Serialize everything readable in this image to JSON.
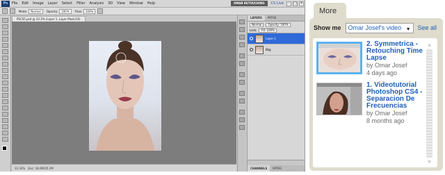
{
  "photoshop": {
    "logo": "Ps",
    "menus": [
      "File",
      "Edit",
      "Image",
      "Layer",
      "Select",
      "Filter",
      "Analysis",
      "3D",
      "View",
      "Window",
      "Help"
    ],
    "workspace_button": "OMAR RETOUCHING",
    "cs_live": "CS Live",
    "options": {
      "mode_label": "Mode:",
      "mode_value": "Normal",
      "opacity_label": "Opacity:",
      "opacity_value": "100%",
      "flow_label": "Flow:",
      "flow_value": "100%"
    },
    "document_tab": "PSCS5.psd @ 33.3% (Layer 1, Layer Mask/16)",
    "status": {
      "zoom": "33.33%",
      "doc_size": "Doc: 18.6M/35.2M"
    },
    "layers_panel": {
      "tabs": [
        "LAYERS",
        "PATHS"
      ],
      "blend_mode": "Normal",
      "opacity": "Opacity: 100%",
      "lock_label": "Lock:",
      "fill": "Fill: 100%",
      "layers": [
        {
          "name": "Layer 1",
          "selected": true
        },
        {
          "name": "Bkg",
          "selected": false
        }
      ],
      "bottom_tabs": [
        "CHANNELS",
        "PATHS"
      ]
    }
  },
  "more_panel": {
    "tab_label": "More",
    "show_me_label": "Show me",
    "show_me_value": "Omar Josef's video",
    "see_all": "See all",
    "videos": [
      {
        "number": "2.",
        "title": "Symmetrica - Retouching Time Lapse",
        "by": "by Omar Josef",
        "age": "4 days ago"
      },
      {
        "number": "1.",
        "title": "Videotutorial Photoshop CS4 - Separacion De Frecuencias",
        "by": "by Omar Josef",
        "age": "8 months ago"
      }
    ]
  }
}
